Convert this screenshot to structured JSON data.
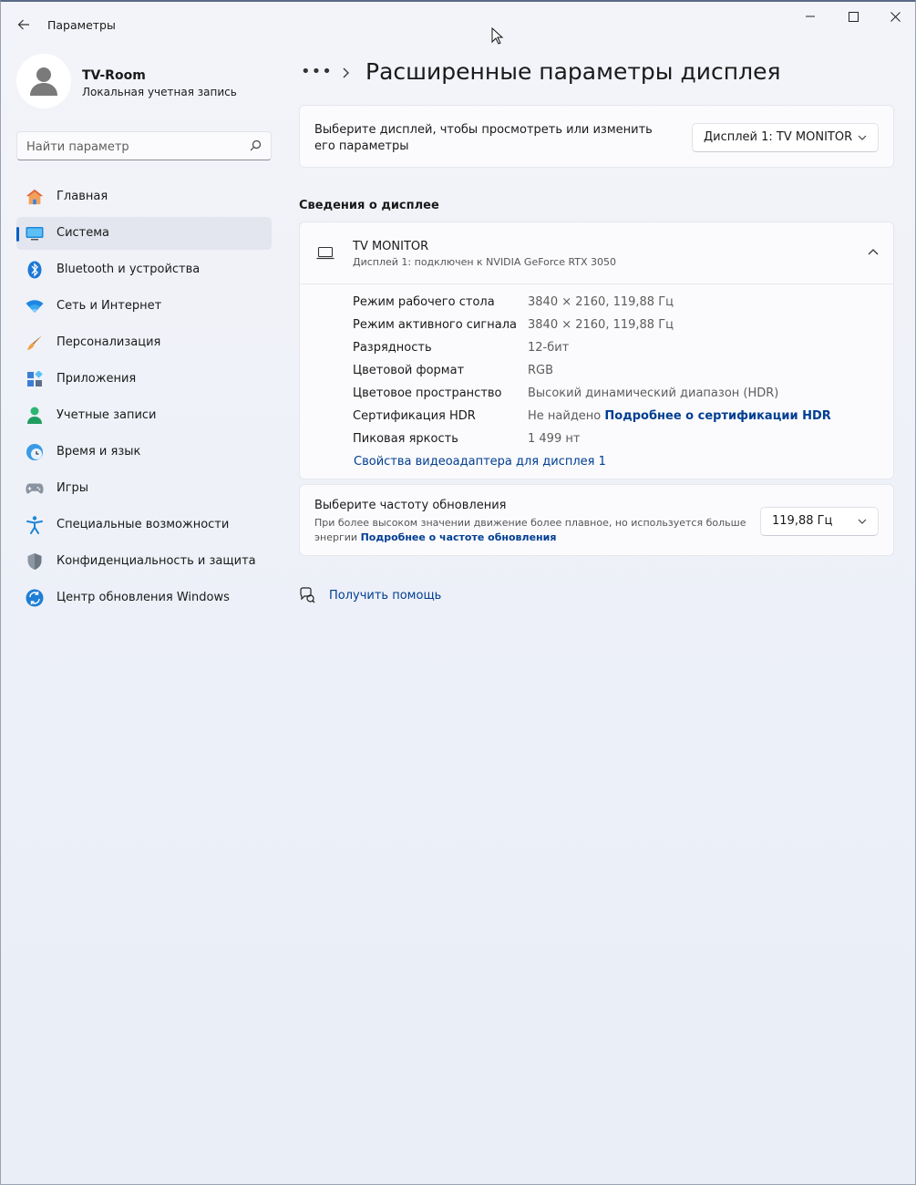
{
  "window": {
    "title": "Параметры"
  },
  "profile": {
    "name": "TV-Room",
    "account_type": "Локальная учетная запись"
  },
  "search": {
    "placeholder": "Найти параметр"
  },
  "nav": {
    "items": [
      {
        "label": "Главная",
        "icon": "home-icon"
      },
      {
        "label": "Система",
        "icon": "system-icon",
        "active": true
      },
      {
        "label": "Bluetooth и устройства",
        "icon": "bluetooth-icon"
      },
      {
        "label": "Сеть и Интернет",
        "icon": "wifi-icon"
      },
      {
        "label": "Персонализация",
        "icon": "brush-icon"
      },
      {
        "label": "Приложения",
        "icon": "apps-icon"
      },
      {
        "label": "Учетные записи",
        "icon": "account-icon"
      },
      {
        "label": "Время и язык",
        "icon": "time-language-icon"
      },
      {
        "label": "Игры",
        "icon": "gamepad-icon"
      },
      {
        "label": "Специальные возможности",
        "icon": "accessibility-icon"
      },
      {
        "label": "Конфиденциальность и защита",
        "icon": "shield-icon"
      },
      {
        "label": "Центр обновления Windows",
        "icon": "update-icon"
      }
    ]
  },
  "breadcrumb": {
    "more": "•••",
    "title": "Расширенные параметры дисплея"
  },
  "display_select": {
    "text": "Выберите дисплей, чтобы просмотреть или изменить его параметры",
    "selected": "Дисплей 1: TV MONITOR"
  },
  "display_info": {
    "section_title": "Сведения о дисплее",
    "name": "TV MONITOR",
    "subtitle": "Дисплей 1: подключен к NVIDIA GeForce RTX 3050",
    "rows": [
      {
        "key": "Режим рабочего стола",
        "value": "3840 × 2160, 119,88 Гц"
      },
      {
        "key": "Режим активного сигнала",
        "value": "3840 × 2160, 119,88 Гц"
      },
      {
        "key": "Разрядность",
        "value": "12-бит"
      },
      {
        "key": "Цветовой формат",
        "value": "RGB"
      },
      {
        "key": "Цветовое пространство",
        "value": "Высокий динамический диапазон (HDR)"
      },
      {
        "key": "Сертификация HDR",
        "value": "Не найдено",
        "link": "Подробнее о сертификации HDR"
      },
      {
        "key": "Пиковая яркость",
        "value": "1 499 нт"
      }
    ],
    "adapter_link": "Свойства видеоадаптера для дисплея 1"
  },
  "refresh": {
    "title": "Выберите частоту обновления",
    "description": "При более высоком значении движение более плавное, но используется больше энергии",
    "link": "Подробнее о частоте обновления",
    "selected": "119,88 Гц"
  },
  "help": {
    "label": "Получить помощь"
  },
  "colors": {
    "accent": "#0a5fc4",
    "link": "#003e92",
    "background": "#eef1f8",
    "card": "#fbfbfd"
  }
}
